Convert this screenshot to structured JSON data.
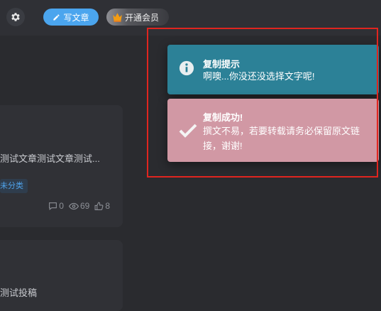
{
  "header": {
    "write_label": "写文章",
    "vip_label": "开通会员",
    "icons": {
      "settings": "gear-icon",
      "write": "pencil-icon",
      "vip": "crown-icon"
    }
  },
  "posts": [
    {
      "excerpt": "测试文章测试文章测试...",
      "category": "未分类",
      "comments": "0",
      "views": "69",
      "likes": "8"
    },
    {
      "title": "测试投稿"
    }
  ],
  "toasts": [
    {
      "type": "info",
      "icon": "info-circle-icon",
      "title": "复制提示",
      "message": "啊噢...你没还没选择文字呢!",
      "color": "#2c8197"
    },
    {
      "type": "success",
      "icon": "checkmark-icon",
      "title": "复制成功!",
      "message": "撰文不易，若要转载请务必保留原文链接，谢谢!",
      "color": "#d198a4"
    }
  ],
  "colors": {
    "accent": "#4ba5ee",
    "highlight_border": "#e0251f",
    "background": "#2a2b2f"
  }
}
